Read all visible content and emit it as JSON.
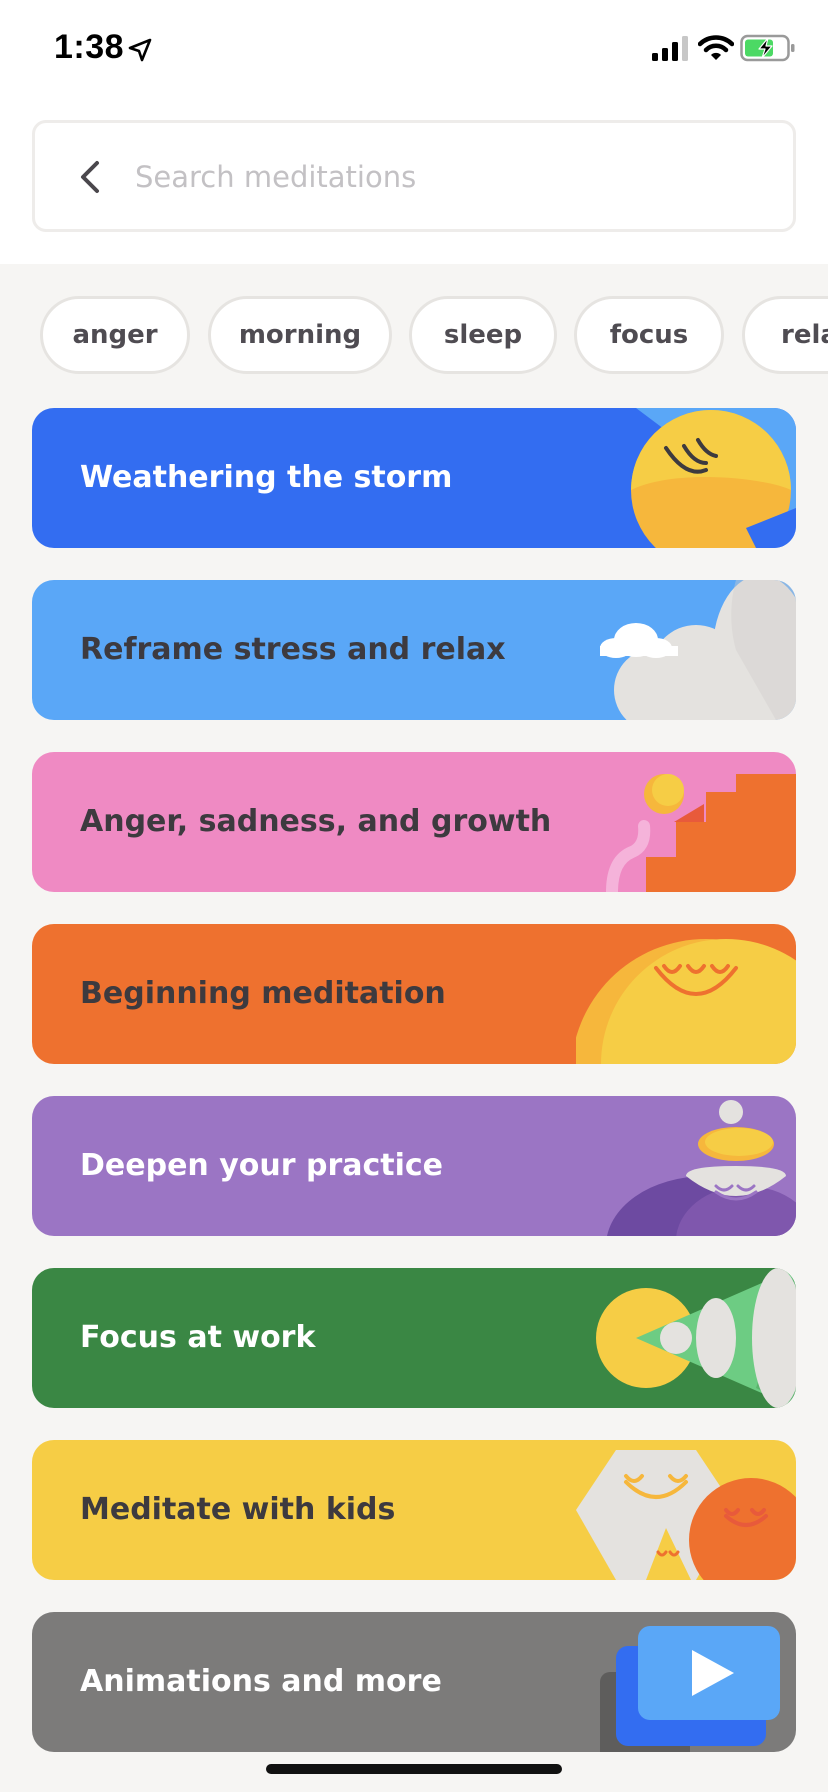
{
  "status_bar": {
    "time": "1:38"
  },
  "search": {
    "placeholder": "Search meditations"
  },
  "chips": [
    "anger",
    "morning",
    "sleep",
    "focus",
    "relax"
  ],
  "cards": [
    {
      "title": "Weathering the storm",
      "background": "#336df1",
      "text_color": "#ffffff"
    },
    {
      "title": "Reframe stress and relax",
      "background": "#5aa7f7",
      "text_color": "#3d3a3f"
    },
    {
      "title": "Anger, sadness, and growth",
      "background": "#ef8ac3",
      "text_color": "#3d3a3f"
    },
    {
      "title": "Beginning meditation",
      "background": "#ee712f",
      "text_color": "#3d3a3f"
    },
    {
      "title": "Deepen your practice",
      "background": "#9b75c4",
      "text_color": "#ffffff"
    },
    {
      "title": "Focus at work",
      "background": "#3a8744",
      "text_color": "#ffffff"
    },
    {
      "title": "Meditate with kids",
      "background": "#f6cd45",
      "text_color": "#3d3a3f"
    },
    {
      "title": "Animations and more",
      "background": "#7c7b7a",
      "text_color": "#ffffff"
    }
  ],
  "colors": {
    "battery_fill": "#4cd964",
    "placeholder": "#c3c1c4"
  }
}
